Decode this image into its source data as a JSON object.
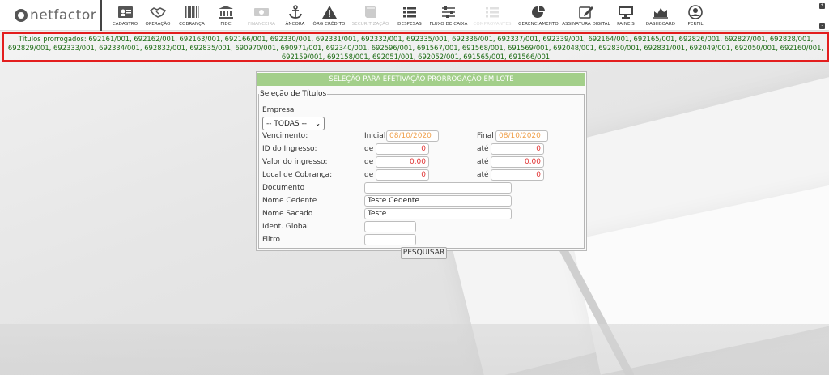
{
  "app": {
    "logo_text": "netfactor"
  },
  "nav": [
    {
      "label": "CADASTRO",
      "icon": "id-card-icon",
      "state": "normal"
    },
    {
      "label": "OPERAÇÃO",
      "icon": "handshake-icon",
      "state": "normal"
    },
    {
      "label": "COBRANÇA",
      "icon": "barcode-icon",
      "state": "normal"
    },
    {
      "label": "FIDC",
      "icon": "bank-icon",
      "state": "normal"
    },
    {
      "label": "FINANCEIRA",
      "icon": "money-icon",
      "state": "disabled"
    },
    {
      "label": "ÂNCORA",
      "icon": "anchor-icon",
      "state": "normal"
    },
    {
      "label": "ÓRG CRÉDITO",
      "icon": "warning-icon",
      "state": "normal"
    },
    {
      "label": "SECURITIZAÇÃO",
      "icon": "book-icon",
      "state": "disabled"
    },
    {
      "label": "DESPESAS",
      "icon": "list-icon",
      "state": "normal"
    },
    {
      "label": "FLUXO DE CAIXA",
      "icon": "sliders-icon",
      "state": "normal"
    },
    {
      "label": "COMPROVANTES",
      "icon": "list-icon",
      "state": "active"
    },
    {
      "label": "GERENCIAMENTO",
      "icon": "pie-chart-icon",
      "state": "normal"
    },
    {
      "label": "ASSINATURA DIGITAL",
      "icon": "edit-icon",
      "state": "normal"
    },
    {
      "label": "PAINEIS",
      "icon": "monitor-icon",
      "state": "normal"
    },
    {
      "label": "DASHBOARD",
      "icon": "area-chart-icon",
      "state": "normal"
    },
    {
      "label": "PERFIL",
      "icon": "user-icon",
      "state": "normal"
    }
  ],
  "alert": {
    "text": "Títulos prorrogados: 692161/001, 692162/001, 692163/001, 692166/001, 692330/001, 692331/001, 692332/001, 692335/001, 692336/001, 692337/001, 692339/001, 692164/001, 692165/001, 692826/001, 692827/001, 692828/001, 692829/001, 692333/001, 692334/001, 692832/001, 692835/001, 690970/001, 690971/001, 692340/001, 692596/001, 691567/001, 691568/001, 691569/001, 692048/001, 692830/001, 692831/001, 692049/001, 692050/001, 692160/001, 692159/001, 692158/001, 692051/001, 692052/001, 691565/001, 691566/001"
  },
  "panel": {
    "title": "SELEÇÃO PARA EFETIVAÇÃO PRORROGAÇÃO EM LOTE",
    "legend": "Seleção de Títulos",
    "empresa_label": "Empresa",
    "empresa_value": "-- TODAS --",
    "vencimento_label": "Vencimento:",
    "inicial_label": "Inicial",
    "inicial_value": "08/10/2020",
    "final_label": "Final",
    "final_value": "08/10/2020",
    "id_label": "ID do Ingresso:",
    "valor_label": "Valor do ingresso:",
    "local_label": "Local de Cobrança:",
    "de_label": "de",
    "ate_label": "até",
    "id_de": "0",
    "id_ate": "0",
    "valor_de": "0,00",
    "valor_ate": "0,00",
    "local_de": "0",
    "local_ate": "0",
    "documento_label": "Documento",
    "documento_value": "",
    "cedente_label": "Nome Cedente",
    "cedente_value": "Teste Cedente",
    "sacado_label": "Nome Sacado",
    "sacado_value": "Teste",
    "ident_label": "Ident. Global",
    "ident_value": "",
    "filtro_label": "Filtro",
    "filtro_value": "",
    "search_button": "PESQUISAR"
  },
  "colors": {
    "alert_border": "#e31e1e",
    "alert_text": "#1c6b14",
    "header_bg": "#a3cf8a",
    "date_text": "#f0a04b",
    "number_text": "#e03030"
  }
}
